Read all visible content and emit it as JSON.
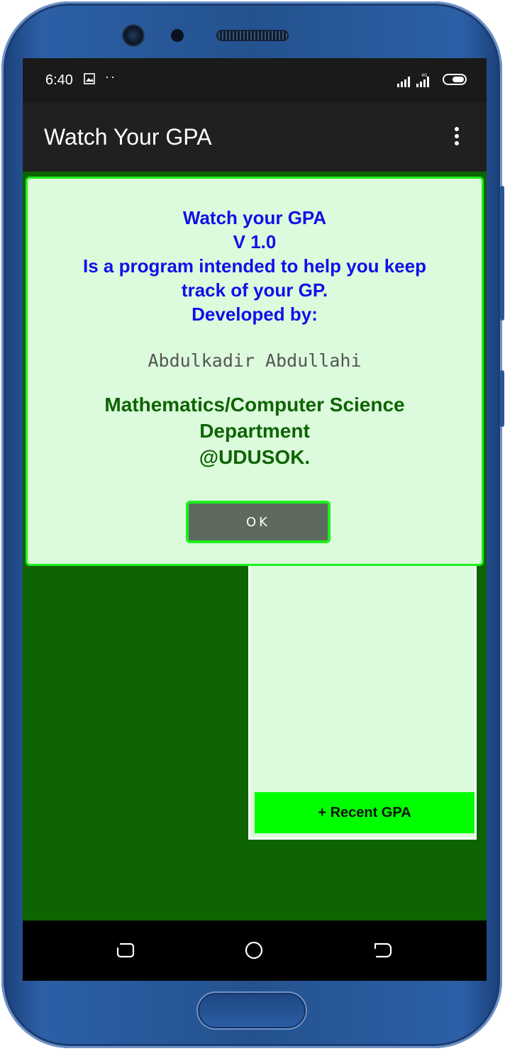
{
  "status_bar": {
    "time": "6:40",
    "dots": "··",
    "icons": [
      "image-icon",
      "signal-icon",
      "battery-icon"
    ]
  },
  "app_bar": {
    "title": "Watch Your GPA",
    "menu_icon": "overflow-menu-icon"
  },
  "about_dialog": {
    "lines": [
      "Watch your GPA",
      "V 1.0",
      "Is a program intended to help you keep",
      "track of your GP.",
      "Developed by:"
    ],
    "developer": "Abdulkadir Abdullahi",
    "department_lines": [
      "Mathematics/Computer Science",
      "Department",
      "@UDUSOK."
    ],
    "ok_label": "OK"
  },
  "main": {
    "recent_gpa_label": "+ Recent GPA"
  },
  "nav_bar": {
    "icons": [
      "recents-icon",
      "home-icon",
      "back-icon"
    ]
  },
  "colors": {
    "background_green": "#0d6400",
    "panel_light_green": "#dcfadc",
    "accent_green": "#00ff00",
    "dialog_text_blue": "#1010e8",
    "dialog_dept_green": "#0d6400",
    "ok_button_gray": "#5e6a5e"
  }
}
